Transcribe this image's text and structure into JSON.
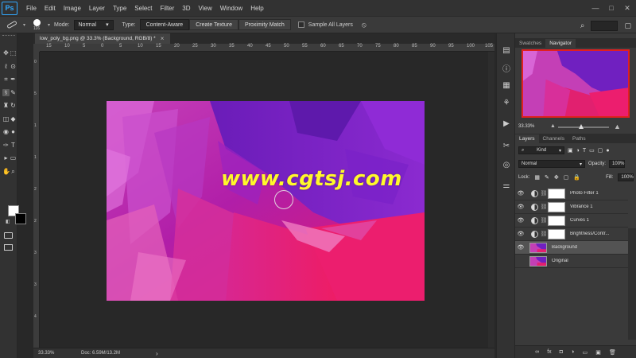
{
  "app": {
    "logo": "Ps"
  },
  "menu": [
    "File",
    "Edit",
    "Image",
    "Layer",
    "Type",
    "Select",
    "Filter",
    "3D",
    "View",
    "Window",
    "Help"
  ],
  "window_controls": {
    "minimize": "—",
    "maximize": "□",
    "close": "✕"
  },
  "options_bar": {
    "brush_size": "116",
    "mode_label": "Mode:",
    "mode_value": "Normal",
    "type_label": "Type:",
    "type_buttons": [
      "Content-Aware",
      "Create Texture",
      "Proximity Match"
    ],
    "active_type": "Content-Aware",
    "sample_all_layers": "Sample All Layers"
  },
  "document": {
    "tab_title": "low_poly_bg.png @ 33.3% (Background, RGB/8) *",
    "close_glyph": "×"
  },
  "ruler": {
    "top_labels": [
      "15",
      "10",
      "5",
      "0",
      "5",
      "10",
      "15",
      "20",
      "25",
      "30",
      "35",
      "40",
      "45",
      "50",
      "55",
      "60",
      "65",
      "70",
      "75",
      "80",
      "85",
      "90",
      "95",
      "100",
      "105"
    ],
    "left_labels": [
      "0",
      "5",
      "1",
      "1",
      "2",
      "2",
      "3",
      "3",
      "4"
    ]
  },
  "canvas": {
    "watermark": "www.cgtsj.com"
  },
  "status_bar": {
    "zoom": "33.33%",
    "doc": "Doc: 6.59M/13.2M",
    "arrow": "›"
  },
  "toolbar_icons": [
    "move-icon",
    "marquee-icon",
    "lasso-icon",
    "quick-select-icon",
    "crop-icon",
    "eyedropper-icon",
    "healing-brush-icon",
    "brush-icon",
    "stamp-icon",
    "history-brush-icon",
    "eraser-icon",
    "bucket-icon",
    "blur-icon",
    "dodge-icon",
    "pen-icon",
    "type-icon",
    "path-select-icon",
    "shape-icon",
    "hand-icon",
    "zoom-icon"
  ],
  "panels": {
    "top_tabs": [
      "Swatches",
      "Navigator"
    ],
    "top_active": "Navigator",
    "navigator_zoom": "33.33%",
    "layer_tabs": [
      "Layers",
      "Channels",
      "Paths"
    ],
    "layer_active": "Layers",
    "filter_kind": "Kind",
    "blend_mode": "Normal",
    "opacity_label": "Opacity:",
    "opacity_value": "100%",
    "lock_label": "Lock:",
    "fill_label": "Fill:",
    "fill_value": "100%",
    "layers": [
      {
        "name": "Photo Filter 1",
        "type": "adjustment",
        "visible": true
      },
      {
        "name": "Vibrance 1",
        "type": "adjustment",
        "visible": true
      },
      {
        "name": "Curves 1",
        "type": "adjustment",
        "visible": true
      },
      {
        "name": "Brightness/Contr...",
        "type": "adjustment",
        "visible": true
      },
      {
        "name": "Background",
        "type": "image",
        "visible": true,
        "selected": true
      },
      {
        "name": "Original",
        "type": "image",
        "visible": false
      }
    ],
    "footer_icons": [
      "link-icon",
      "fx-icon",
      "mask-icon",
      "adjustment-icon",
      "folder-icon",
      "new-layer-icon",
      "trash-icon"
    ],
    "footer_glyphs": [
      "∞",
      "fx",
      "◘",
      "◑",
      "▭",
      "▣",
      "🗑"
    ]
  },
  "colors": {
    "accent": "#31a8ff",
    "watermark": "#fff82b",
    "nav_frame": "#e02020"
  }
}
